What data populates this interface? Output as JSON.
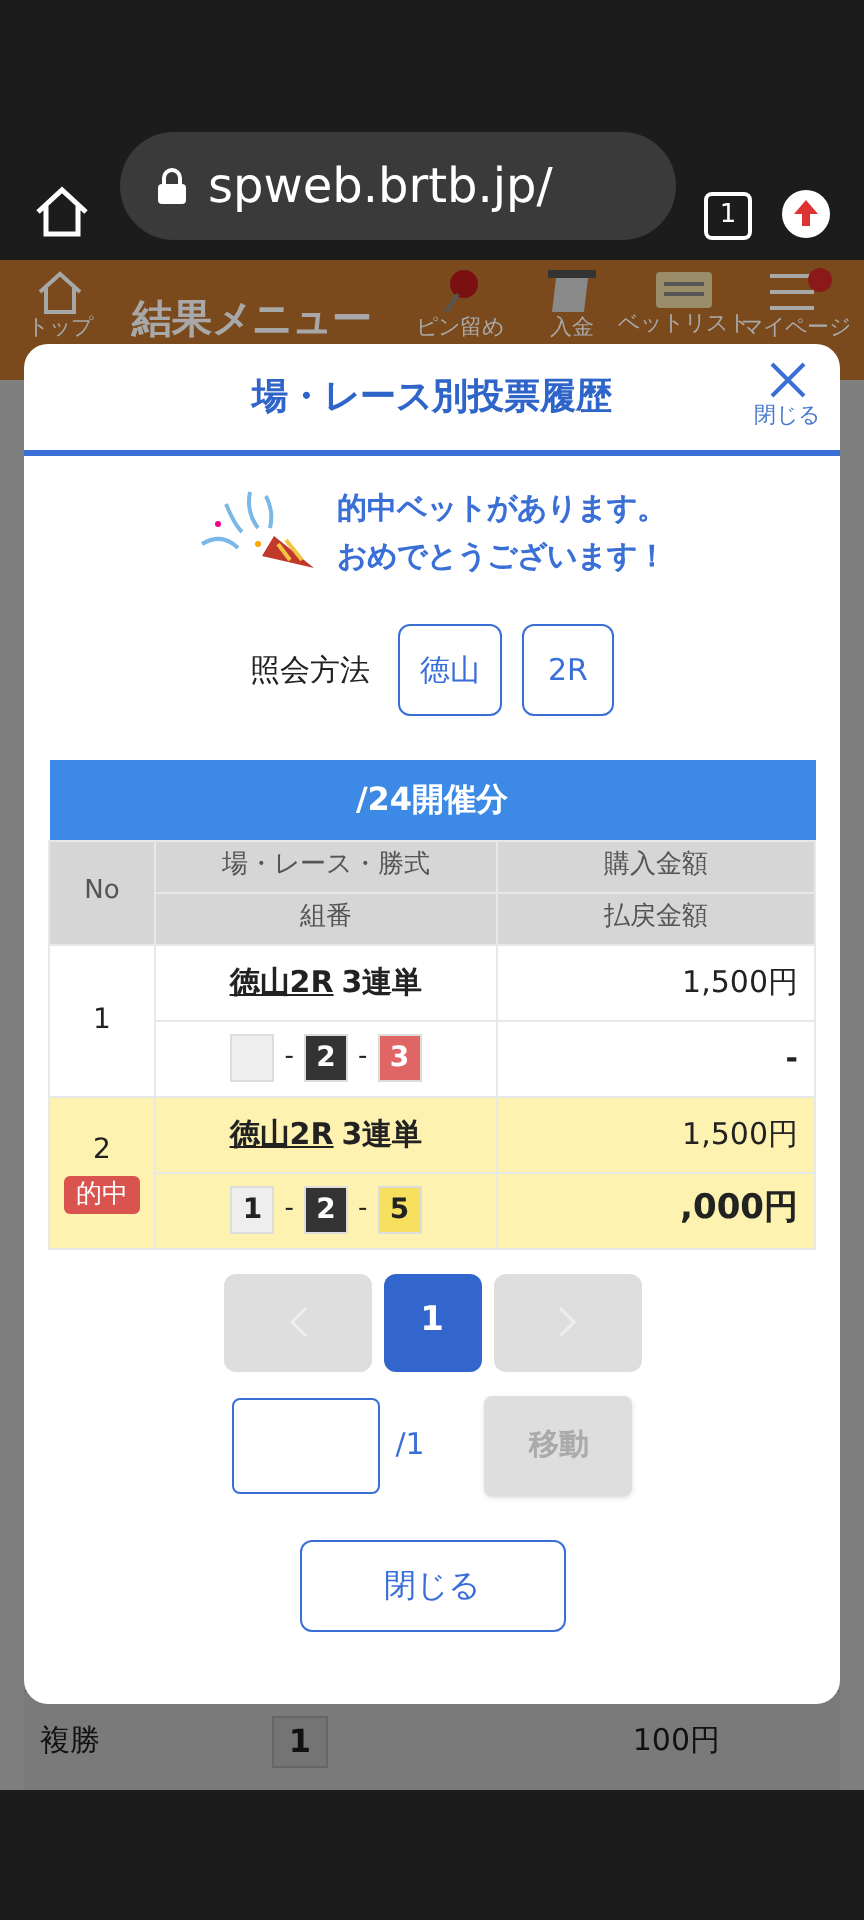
{
  "browser": {
    "url": "spweb.brtb.jp/",
    "tab_count": "1"
  },
  "header": {
    "title": "結果メニュー",
    "nav": [
      {
        "kind": "home",
        "label": "トップ",
        "notification": false
      },
      {
        "kind": "pin",
        "label": "ピン留め",
        "notification": false
      },
      {
        "kind": "deposit",
        "label": "入金",
        "notification": false
      },
      {
        "kind": "betlist",
        "label": "ベットリスト",
        "notification": false
      },
      {
        "kind": "menu",
        "label": "マイページ",
        "notification": true
      }
    ]
  },
  "background_row": {
    "bet_type": "複勝",
    "number": "1",
    "amount": "100円"
  },
  "modal": {
    "title": "場・レース別投票履歴",
    "close_label": "閉じる",
    "message": [
      "的中ベットがあります。",
      "おめでとうございます！"
    ],
    "query": {
      "label": "照会方法",
      "buttons": [
        "徳山",
        "2R"
      ]
    },
    "table": {
      "date_heading": "/24開催分",
      "columns": [
        "No",
        "場・レース・勝式",
        "組番",
        "購入金額",
        "払戻金額"
      ],
      "rows": [
        {
          "no": "1",
          "hit": false,
          "race": "徳山2R",
          "bet_type": "3連単",
          "separator": "-",
          "numbers": [
            {
              "color": "#eeeeee"
            },
            {
              "n": "2",
              "color": "#333333"
            },
            {
              "n": "3",
              "color": "#e06666"
            }
          ],
          "purchase": "1,500円",
          "payout": "-"
        },
        {
          "no": "2",
          "hit": true,
          "badge": "的中",
          "race": "徳山2R",
          "bet_type": "3連単",
          "separator": "-",
          "numbers": [
            {
              "n": "1",
              "color": "#eeeeee"
            },
            {
              "n": "2",
              "color": "#333333"
            },
            {
              "n": "5",
              "color": "#f6e05e"
            }
          ],
          "purchase": "1,500円",
          "payout": ",000円"
        }
      ]
    },
    "pager": {
      "prev_disabled": true,
      "next_disabled": true,
      "pages": [
        {
          "label": "1",
          "selected": true
        }
      ]
    },
    "page_jump": {
      "total": "/1",
      "button": {
        "label": "移動",
        "disabled": true
      }
    },
    "close_button": "閉じる"
  }
}
